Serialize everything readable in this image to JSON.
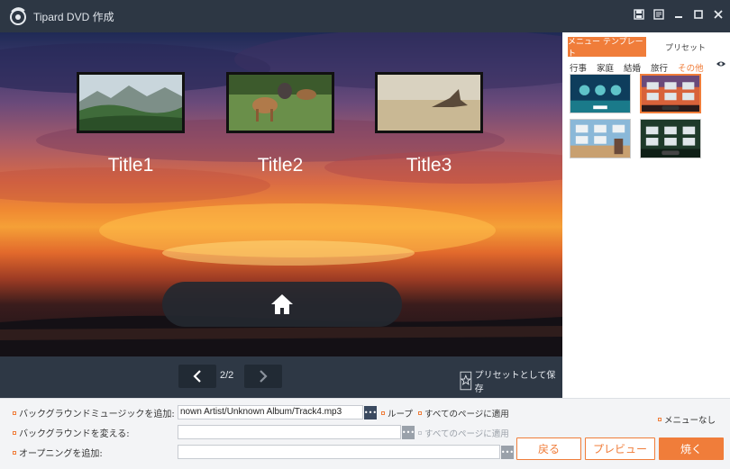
{
  "window": {
    "title": "Tipard DVD 作成"
  },
  "preview": {
    "titles": [
      "Title1",
      "Title2",
      "Title3"
    ],
    "page_indicator": "2/2",
    "save_preset": "プリセットとして保存"
  },
  "panel": {
    "tabs": [
      "メニュー テンプレート",
      "プリセット"
    ],
    "categories": [
      "行事",
      "家庭",
      "結婚",
      "旅行",
      "その他"
    ],
    "active_category": "その他"
  },
  "bottom": {
    "bg_music_label": "バックグラウンドミュージックを追加:",
    "bg_music_value": "nown Artist/Unknown Album/Track4.mp3",
    "loop_label": "ループ",
    "apply_all_1": "すべてのページに適用",
    "change_bg_label": "バックグラウンドを変える:",
    "apply_all_2": "すべてのページに適用",
    "opening_label": "オープニングを追加:",
    "no_menu_label": "メニューなし",
    "back_button": "戻る",
    "preview_button": "プレビュー",
    "burn_button": "焼く"
  },
  "colors": {
    "accent": "#f07d3a",
    "titlebar": "#2d3744",
    "navbar": "#2e3845"
  }
}
